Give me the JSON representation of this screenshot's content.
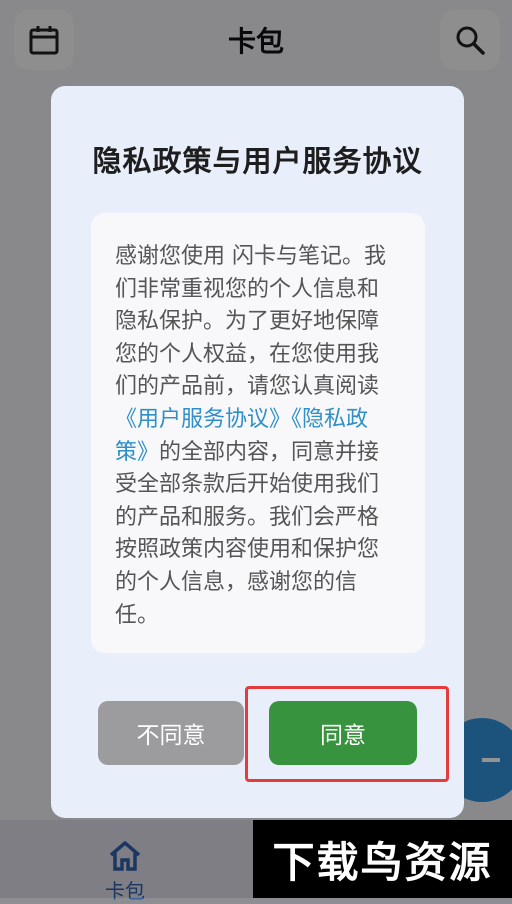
{
  "app": {
    "title": "卡包"
  },
  "header": {
    "calendar_icon": "calendar-icon",
    "search_icon": "search-icon"
  },
  "fab": {
    "icon": "plus-icon",
    "color": "#2f8fd8"
  },
  "bottom_nav": {
    "items": [
      {
        "label": "卡包",
        "icon": "home-icon"
      }
    ]
  },
  "dialog": {
    "title": "隐私政策与用户服务协议",
    "body_intro": "感谢您使用 闪卡与笔记。我们非常重视您的个人信息和隐私保护。为了更好地保障您的个人权益，在您使用我们的产品前，请您认真阅读",
    "link_terms": "《用户服务协议》",
    "link_privacy": "《隐私政策》",
    "body_outro": "的全部内容，同意并接受全部条款后开始使用我们的产品和服务。我们会严格按照政策内容使用和保护您的个人信息，感谢您的信任。",
    "decline_label": "不同意",
    "agree_label": "同意"
  },
  "watermark": {
    "text": "下载鸟资源"
  },
  "colors": {
    "agree": "#38933e",
    "decline": "#9c9c9f",
    "link": "#2f8fc8",
    "highlight": "#e53b3b"
  }
}
